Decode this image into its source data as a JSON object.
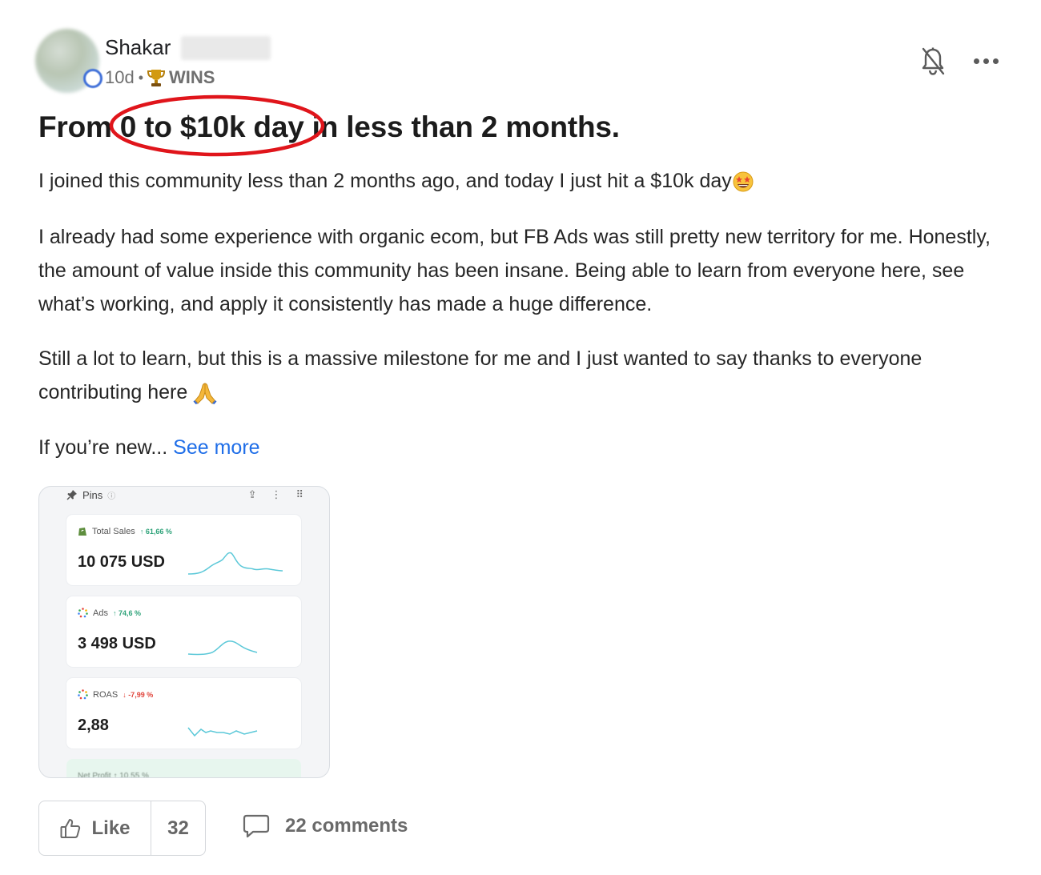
{
  "post": {
    "author_name": "Shakar",
    "age": "10d",
    "separator": "•",
    "category": "WINS",
    "title": "From 0 to $10k day in less than 2 months.",
    "paragraphs": [
      "I joined this community less than 2 months ago, and today I just hit a $10k day",
      "I already had some experience with organic ecom, but FB Ads was still pretty new territory for me. Honestly, the amount of value inside this community has been insane. Being able to learn from everyone here, see what’s working, and apply it consistently has made a huge difference.",
      "Still a lot to learn, but this is a massive milestone for me and I just wanted to say thanks to everyone contributing here",
      "If you’re new..."
    ],
    "see_more": "See more",
    "icons": [
      "trophy-icon",
      "bell-off-icon",
      "more-icon",
      "star-struck-emoji",
      "folded-hands-emoji"
    ]
  },
  "attachment": {
    "header": "Pins",
    "cards": [
      {
        "label": "Total Sales",
        "change": "↑ 61,66 %",
        "trend": "up",
        "value": "10 075 USD"
      },
      {
        "label": "Ads",
        "change": "↑ 74,6 %",
        "trend": "up",
        "value": "3 498 USD"
      },
      {
        "label": "ROAS",
        "change": "↓ -7,99 %",
        "trend": "down",
        "value": "2,88"
      }
    ],
    "partial_card_label": "Net Profit ↑ 10,55 %"
  },
  "actions": {
    "like_label": "Like",
    "like_count": "32",
    "comments_label": "22 comments"
  },
  "colors": {
    "link": "#1f6ee8",
    "highlight_ellipse": "#e0151b",
    "positive": "#2fa37a",
    "negative": "#e0443b",
    "sparkline": "#5bc8d8"
  }
}
